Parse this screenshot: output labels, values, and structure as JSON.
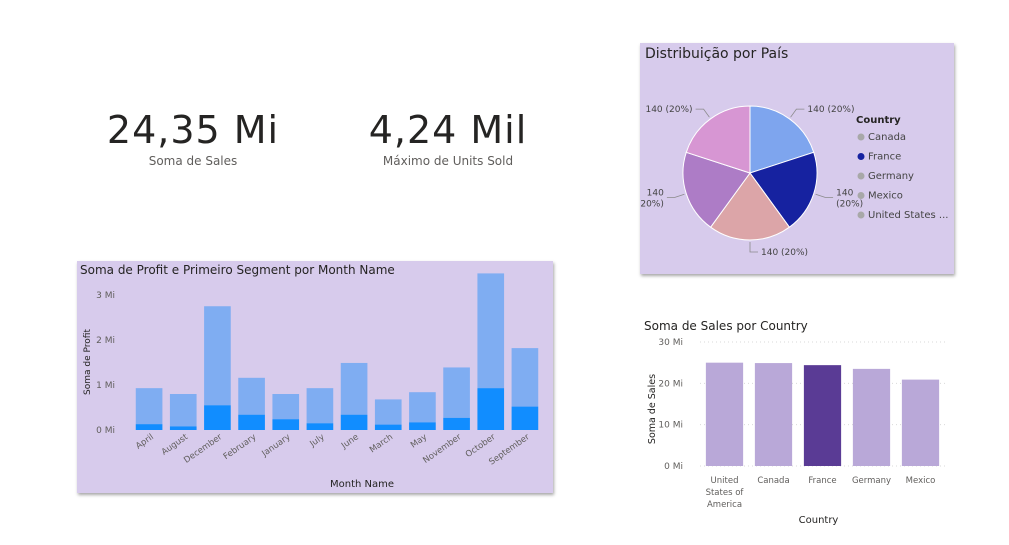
{
  "kpis": {
    "sales": {
      "value": "24,35 Mi",
      "label": "Soma de  Sales"
    },
    "units": {
      "value": "4,24 Mil",
      "label": "Máximo de Units Sold"
    }
  },
  "charts": {
    "pie": {
      "title": "Distribuição por País",
      "legend_title": "Country"
    },
    "monthly": {
      "title": "Soma de Profit e Primeiro Segment por Month Name"
    },
    "country": {
      "title": "Soma de Sales por Country"
    }
  },
  "chart_data": [
    {
      "id": "pie",
      "type": "pie",
      "title": "Distribuição por País",
      "legend_title": "Country",
      "legend_placement": "right",
      "slices": [
        {
          "name": "Canada",
          "value": 140,
          "label": "140 (20%)",
          "color": "#7ea5ee"
        },
        {
          "name": "France",
          "value": 140,
          "label": "140 (20%)",
          "color": "#1622a0"
        },
        {
          "name": "Germany",
          "value": 140,
          "label": "140 (20%)",
          "color": "#dca5a8"
        },
        {
          "name": "Mexico",
          "value": 140,
          "label": "140 (20%)",
          "color": "#ad7cc6"
        },
        {
          "name": "United States of America",
          "value": 140,
          "label": "140 (20%)",
          "color": "#d796d3"
        }
      ],
      "legend_labels": [
        "Canada",
        "France",
        "Germany",
        "Mexico",
        "United States ..."
      ],
      "legend_colors": [
        "#a8a8a8",
        "#1622a0",
        "#a8a8a8",
        "#a8a8a8",
        "#a8a8a8"
      ]
    },
    {
      "id": "monthly",
      "type": "bar",
      "title": "Soma de Profit e Primeiro Segment por Month Name",
      "xlabel": "Month Name",
      "ylabel": "Soma de Profit",
      "ylim": [
        0,
        3.2
      ],
      "yticks": [
        0,
        1,
        2,
        3
      ],
      "ytick_labels": [
        "0 Mi",
        "1 Mi",
        "2 Mi",
        "3 Mi"
      ],
      "grid": false,
      "categories": [
        "April",
        "August",
        "December",
        "February",
        "January",
        "July",
        "June",
        "March",
        "May",
        "November",
        "October",
        "September"
      ],
      "series": [
        {
          "values": [
            0.13,
            0.08,
            0.55,
            0.34,
            0.24,
            0.15,
            0.34,
            0.12,
            0.17,
            0.27,
            0.93,
            0.52
          ],
          "color": "#118dff"
        },
        {
          "values": [
            0.8,
            0.72,
            2.2,
            0.82,
            0.56,
            0.78,
            1.15,
            0.56,
            0.67,
            1.12,
            2.55,
            1.3
          ],
          "color": "#7fadf2"
        }
      ]
    },
    {
      "id": "country",
      "type": "bar",
      "title": "Soma de Sales por Country",
      "xlabel": "Country",
      "ylabel": "Soma de Sales",
      "ylim": [
        0,
        30
      ],
      "yticks": [
        0,
        10,
        20,
        30
      ],
      "ytick_labels": [
        "0 Mi",
        "10 Mi",
        "20 Mi",
        "30 Mi"
      ],
      "grid": true,
      "categories": [
        "United States of America",
        "Canada",
        "France",
        "Germany",
        "Mexico"
      ],
      "values": [
        25.0,
        24.9,
        24.4,
        23.5,
        20.9
      ],
      "colors": [
        "#b9a8d8",
        "#b9a8d8",
        "#5a3b95",
        "#b9a8d8",
        "#b9a8d8"
      ]
    }
  ]
}
